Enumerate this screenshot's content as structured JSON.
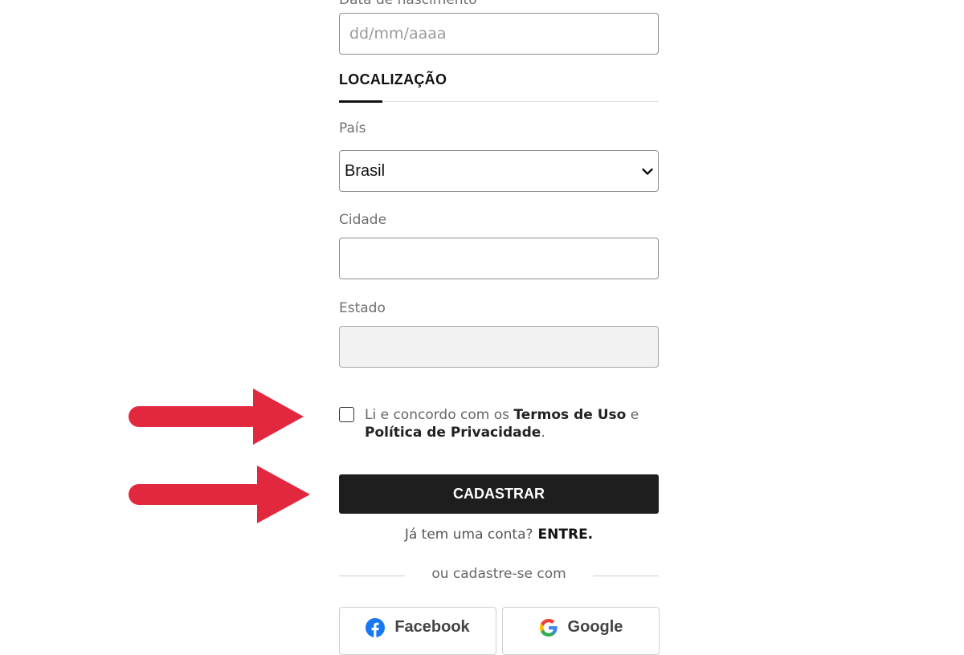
{
  "form": {
    "birthdate_label": "Data de nascimento",
    "birthdate_placeholder": "dd/mm/aaaa",
    "section_title": "LOCALIZAÇÃO",
    "country_label": "País",
    "country_value": "Brasil",
    "city_label": "Cidade",
    "city_value": "",
    "state_label": "Estado",
    "state_value": "",
    "terms_prefix": "Li e concordo com os",
    "terms_link": "Termos de Uso",
    "terms_middle": "e",
    "privacy_link": "Política de Privacidade",
    "terms_suffix": ".",
    "terms_checked": false,
    "submit_label": "CADASTRAR",
    "login_prompt": "Já tem uma conta?",
    "login_link": "ENTRE.",
    "divider_text": "ou cadastre-se com",
    "facebook_label": "Facebook",
    "google_label": "Google"
  },
  "annotations": {
    "arrow_color": "#e2283f",
    "arrows": [
      "arrow-icon",
      "arrow-icon"
    ]
  },
  "icons": {
    "select_chevron": "chevron-down-icon",
    "facebook": "facebook-icon",
    "google": "google-icon"
  }
}
